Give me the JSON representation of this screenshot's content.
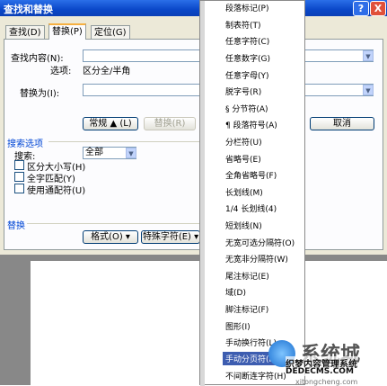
{
  "window": {
    "title": "查找和替换",
    "help_label": "?",
    "close_label": "X"
  },
  "tabs": [
    {
      "label": "查找(D)"
    },
    {
      "label": "替换(P)"
    },
    {
      "label": "定位(G)"
    }
  ],
  "find": {
    "label": "查找内容(N):",
    "options_label": "选项:",
    "options_value": "区分全/半角",
    "value": ""
  },
  "replace": {
    "label": "替换为(I):",
    "value": ""
  },
  "buttons": {
    "less": "常规 ▲ (L)",
    "replace": "替换(R)",
    "cancel": "取消"
  },
  "search_options": {
    "heading": "搜索选项",
    "search_label": "搜索:",
    "search_value": "全部",
    "checkboxes": [
      {
        "label": "区分大小写(H)"
      },
      {
        "label": "全字匹配(Y)"
      },
      {
        "label": "使用通配符(U)"
      }
    ]
  },
  "replace_section": {
    "heading": "替换",
    "format_button": "格式(O) ▾",
    "special_button": "特殊字符(E) ▾"
  },
  "menu": {
    "items": [
      {
        "label": "段落标记(P)"
      },
      {
        "label": "制表符(T)"
      },
      {
        "label": "任意字符(C)"
      },
      {
        "label": "任意数字(G)"
      },
      {
        "label": "任意字母(Y)"
      },
      {
        "label": "脱字号(R)"
      },
      {
        "label": "§ 分节符(A)"
      },
      {
        "label": "¶ 段落符号(A)"
      },
      {
        "label": "分栏符(U)"
      },
      {
        "label": "省略号(E)"
      },
      {
        "label": "全角省略号(F)"
      },
      {
        "label": "长划线(M)"
      },
      {
        "label": "1/4 长划线(4)"
      },
      {
        "label": "短划线(N)"
      },
      {
        "label": "无宽可选分隔符(O)"
      },
      {
        "label": "无宽非分隔符(W)"
      },
      {
        "label": "尾注标记(E)"
      },
      {
        "label": "域(D)"
      },
      {
        "label": "脚注标记(F)"
      },
      {
        "label": "图形(I)"
      },
      {
        "label": "手动换行符(L)"
      },
      {
        "label": "手动分页符(K)"
      },
      {
        "label": "不间断连字符(H)"
      }
    ],
    "highlighted_index": 21,
    "highlight_color": "#3d5db0"
  },
  "watermark": {
    "brand": "系统城",
    "text": "织梦内容管理系统",
    "url": "DEDECMS.COM",
    "url2": "xitongcheng.com"
  },
  "colors": {
    "titlebar": "#0a47c8",
    "dialog_bg": "#ece9d8",
    "section_heading": "#0046d5"
  }
}
